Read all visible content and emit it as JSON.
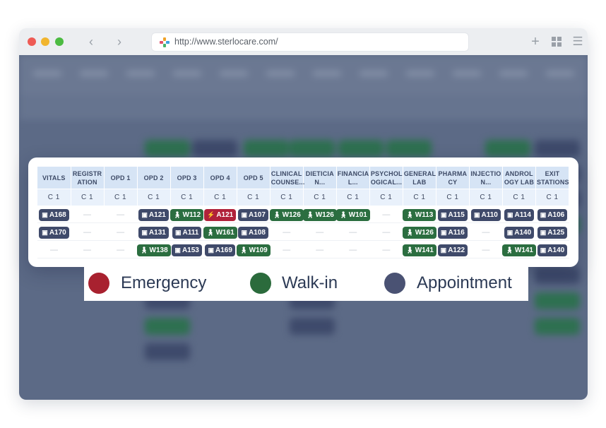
{
  "browser": {
    "url": "http://www.sterlocare.com/",
    "back_icon": "chevron-left-icon",
    "forward_icon": "chevron-right-icon",
    "new_tab_icon": "plus-icon",
    "grid_icon": "grid-icon",
    "menu_icon": "hamburger-icon"
  },
  "queue_table": {
    "columns": [
      {
        "label": "VITALS",
        "sub": "C 1",
        "cells": [
          {
            "type": "appointment",
            "text": "A168"
          },
          {
            "type": "appointment",
            "text": "A170"
          },
          {
            "type": "empty",
            "text": "—"
          }
        ]
      },
      {
        "label": "REGISTR ATION",
        "sub": "C 1",
        "cells": [
          {
            "type": "empty",
            "text": "—"
          },
          {
            "type": "empty",
            "text": "—"
          },
          {
            "type": "empty",
            "text": "—"
          }
        ]
      },
      {
        "label": "OPD 1",
        "sub": "C 1",
        "cells": [
          {
            "type": "empty",
            "text": "—"
          },
          {
            "type": "empty",
            "text": "—"
          },
          {
            "type": "empty",
            "text": "—"
          }
        ]
      },
      {
        "label": "OPD 2",
        "sub": "C 1",
        "cells": [
          {
            "type": "appointment",
            "text": "A121"
          },
          {
            "type": "appointment",
            "text": "A131"
          },
          {
            "type": "walk-in",
            "text": "W138"
          }
        ]
      },
      {
        "label": "OPD 3",
        "sub": "C 1",
        "cells": [
          {
            "type": "walk-in",
            "text": "W112"
          },
          {
            "type": "appointment",
            "text": "A111"
          },
          {
            "type": "appointment",
            "text": "A153"
          }
        ]
      },
      {
        "label": "OPD 4",
        "sub": "C 1",
        "cells": [
          {
            "type": "emergency",
            "text": "A121"
          },
          {
            "type": "walk-in",
            "text": "W161"
          },
          {
            "type": "appointment",
            "text": "A169"
          }
        ]
      },
      {
        "label": "OPD 5",
        "sub": "C 1",
        "cells": [
          {
            "type": "appointment",
            "text": "A107"
          },
          {
            "type": "appointment",
            "text": "A108"
          },
          {
            "type": "walk-in",
            "text": "W109"
          }
        ]
      },
      {
        "label": "CLINICAL COUNSE...",
        "sub": "C 1",
        "cells": [
          {
            "type": "walk-in",
            "text": "W126"
          },
          {
            "type": "empty",
            "text": "—"
          },
          {
            "type": "empty",
            "text": "—"
          }
        ]
      },
      {
        "label": "DIETICIA N...",
        "sub": "C 1",
        "cells": [
          {
            "type": "walk-in",
            "text": "W126"
          },
          {
            "type": "empty",
            "text": "—"
          },
          {
            "type": "empty",
            "text": "—"
          }
        ]
      },
      {
        "label": "FINANCIA L...",
        "sub": "C 1",
        "cells": [
          {
            "type": "walk-in",
            "text": "W101"
          },
          {
            "type": "empty",
            "text": "—"
          },
          {
            "type": "empty",
            "text": "—"
          }
        ]
      },
      {
        "label": "PSYCHOL OGICAL...",
        "sub": "C 1",
        "cells": [
          {
            "type": "empty",
            "text": "—"
          },
          {
            "type": "empty",
            "text": "—"
          },
          {
            "type": "empty",
            "text": "—"
          }
        ]
      },
      {
        "label": "GENERAL LAB",
        "sub": "C 1",
        "cells": [
          {
            "type": "walk-in",
            "text": "W113"
          },
          {
            "type": "walk-in",
            "text": "W126"
          },
          {
            "type": "walk-in",
            "text": "W141"
          }
        ]
      },
      {
        "label": "PHARMA CY",
        "sub": "C 1",
        "cells": [
          {
            "type": "appointment",
            "text": "A115"
          },
          {
            "type": "appointment",
            "text": "A116"
          },
          {
            "type": "appointment",
            "text": "A122"
          }
        ]
      },
      {
        "label": "INJECTIO N...",
        "sub": "C 1",
        "cells": [
          {
            "type": "appointment",
            "text": "A110"
          },
          {
            "type": "empty",
            "text": "—"
          },
          {
            "type": "empty",
            "text": "—"
          }
        ]
      },
      {
        "label": "ANDROL OGY LAB",
        "sub": "C 1",
        "cells": [
          {
            "type": "appointment",
            "text": "A114"
          },
          {
            "type": "appointment",
            "text": "A140"
          },
          {
            "type": "walk-in",
            "text": "W141"
          }
        ]
      },
      {
        "label": "EXIT STATIONS",
        "sub": "C 1",
        "cells": [
          {
            "type": "appointment",
            "text": "A106"
          },
          {
            "type": "appointment",
            "text": "A125"
          },
          {
            "type": "appointment",
            "text": "A140"
          }
        ]
      }
    ]
  },
  "legend": [
    {
      "label": "Emergency",
      "color": "#a8212f"
    },
    {
      "label": "Walk-in",
      "color": "#2b6b3c"
    },
    {
      "label": "Appointment",
      "color": "#4a5273"
    }
  ],
  "colors": {
    "emergency": "#b0223a",
    "walk_in": "#2b6e40",
    "appointment": "#3f4a6a",
    "header_bg": "#d6e4f5"
  },
  "icons": {
    "appointment": "calendar-icon",
    "walk-in": "walking-person-icon",
    "emergency": "lightning-icon"
  }
}
